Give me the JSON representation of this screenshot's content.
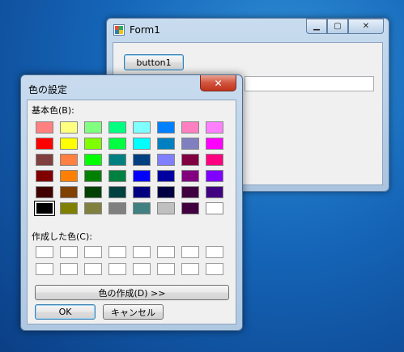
{
  "form1": {
    "title": "Form1",
    "minimize": "▁",
    "maximize": "▢",
    "close": "✕",
    "button1_label": "button1",
    "textbox_value": ""
  },
  "dialog": {
    "title": "色の設定",
    "close": "✕",
    "basic_label": "基本色(B):",
    "custom_label": "作成した色(C):",
    "define_label": "色の作成(D) >>",
    "ok_label": "OK",
    "cancel_label": "キャンセル",
    "selected_index": 40,
    "basic_colors": [
      "#ff8080",
      "#ffff80",
      "#80ff80",
      "#00ff80",
      "#80ffff",
      "#0080ff",
      "#ff80c0",
      "#ff80ff",
      "#ff0000",
      "#ffff00",
      "#80ff00",
      "#00ff40",
      "#00ffff",
      "#0080c0",
      "#8080c0",
      "#ff00ff",
      "#804040",
      "#ff8040",
      "#00ff00",
      "#008080",
      "#004080",
      "#8080ff",
      "#800040",
      "#ff0080",
      "#800000",
      "#ff8000",
      "#008000",
      "#008040",
      "#0000ff",
      "#0000a0",
      "#800080",
      "#8000ff",
      "#400000",
      "#804000",
      "#004000",
      "#004040",
      "#000080",
      "#000040",
      "#400040",
      "#400080",
      "#000000",
      "#808000",
      "#808040",
      "#808080",
      "#408080",
      "#c0c0c0",
      "#400040",
      "#ffffff"
    ],
    "custom_colors": [
      "#ffffff",
      "#ffffff",
      "#ffffff",
      "#ffffff",
      "#ffffff",
      "#ffffff",
      "#ffffff",
      "#ffffff",
      "#ffffff",
      "#ffffff",
      "#ffffff",
      "#ffffff",
      "#ffffff",
      "#ffffff",
      "#ffffff",
      "#ffffff"
    ]
  }
}
